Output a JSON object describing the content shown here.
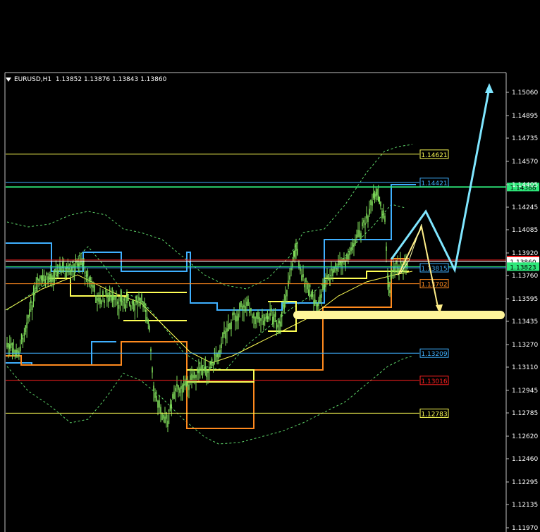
{
  "header": {
    "symbol": "EURUSD,H1",
    "ohlc": "1.13852 1.13876 1.13843 1.13860"
  },
  "colors": {
    "background": "#000000",
    "price_axis_text": "#ffffff",
    "candles": "#7fdc5a",
    "bands": "#5fd66a",
    "ma": "#ffff55",
    "cyan_lines": "#3fb0ff",
    "orange_lines": "#ff8a1e",
    "yellow_lines": "#ffff55",
    "arrow_cyan": "#7fe6ff",
    "arrow_yellow": "#ffee88",
    "zone": "#fff59a"
  },
  "chart_data": {
    "type": "candlestick",
    "ylim": [
      1.1208,
      1.1516
    ],
    "price_ticks": [
      "1.15060",
      "1.14895",
      "1.14735",
      "1.14570",
      "1.14405",
      "1.14245",
      "1.14085",
      "1.13920",
      "1.13760",
      "1.13595",
      "1.13435",
      "1.13270",
      "1.13110",
      "1.12945",
      "1.12785",
      "1.12620",
      "1.12460",
      "1.12295",
      "1.12135",
      "1.11970"
    ],
    "level_lines": [
      {
        "price": 1.14621,
        "label": "1.14621",
        "color": "#ffff55"
      },
      {
        "price": 1.14421,
        "label": "1.14421",
        "color": "#3fb0ff"
      },
      {
        "price": 1.14388,
        "label": "1.14388",
        "color": "#2ee87a",
        "fill": true
      },
      {
        "price": 1.1387,
        "label": "1.13870",
        "color": "#ff2020",
        "fill": true
      },
      {
        "price": 1.1386,
        "label": "1.13860",
        "color": "#ffffff",
        "fill": true
      },
      {
        "price": 1.13823,
        "label": "1.13823",
        "color": "#2ee87a",
        "fill": true
      },
      {
        "price": 1.13815,
        "label": "1.13815",
        "color": "#3fb0ff"
      },
      {
        "price": 1.13702,
        "label": "1.13702",
        "color": "#ff8a1e"
      },
      {
        "price": 1.13209,
        "label": "1.13209",
        "color": "#3fb0ff"
      },
      {
        "price": 1.13016,
        "label": "1.13016",
        "color": "#ff2020"
      },
      {
        "price": 1.12783,
        "label": "1.12783",
        "color": "#ffff55"
      }
    ]
  }
}
